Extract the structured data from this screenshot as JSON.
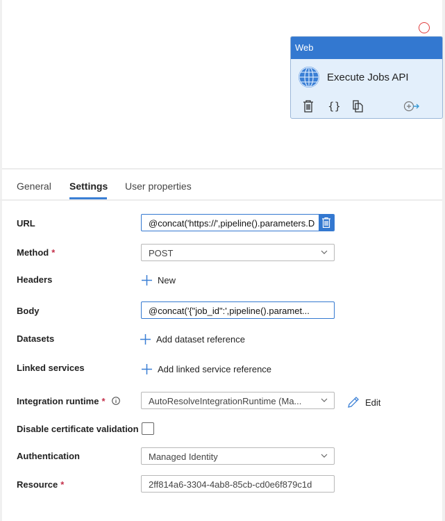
{
  "activity": {
    "type_label": "Web",
    "name": "Execute Jobs API"
  },
  "tabs": [
    {
      "label": "General"
    },
    {
      "label": "Settings"
    },
    {
      "label": "User properties"
    }
  ],
  "form": {
    "url": {
      "label": "URL",
      "value": "@concat('https://',pipeline().parameters.D"
    },
    "method": {
      "label": "Method",
      "required": "*",
      "value": "POST"
    },
    "headers": {
      "label": "Headers",
      "action": "New"
    },
    "body": {
      "label": "Body",
      "value": "@concat('{\"job_id\":',pipeline().paramet..."
    },
    "datasets": {
      "label": "Datasets",
      "action": "Add dataset reference"
    },
    "linked_services": {
      "label": "Linked services",
      "action": "Add linked service reference"
    },
    "integration_runtime": {
      "label": "Integration runtime",
      "required": "*",
      "value": "AutoResolveIntegrationRuntime (Ma...",
      "edit": "Edit"
    },
    "disable_cert": {
      "label": "Disable certificate validation",
      "checked": false
    },
    "authentication": {
      "label": "Authentication",
      "value": "Managed Identity"
    },
    "resource": {
      "label": "Resource",
      "required": "*",
      "value": "2ff814a6-3304-4ab8-85cb-cd0e6f879c1d"
    }
  },
  "colors": {
    "accent": "#3378d0",
    "error": "#e03c3c",
    "required": "#c4314b"
  }
}
